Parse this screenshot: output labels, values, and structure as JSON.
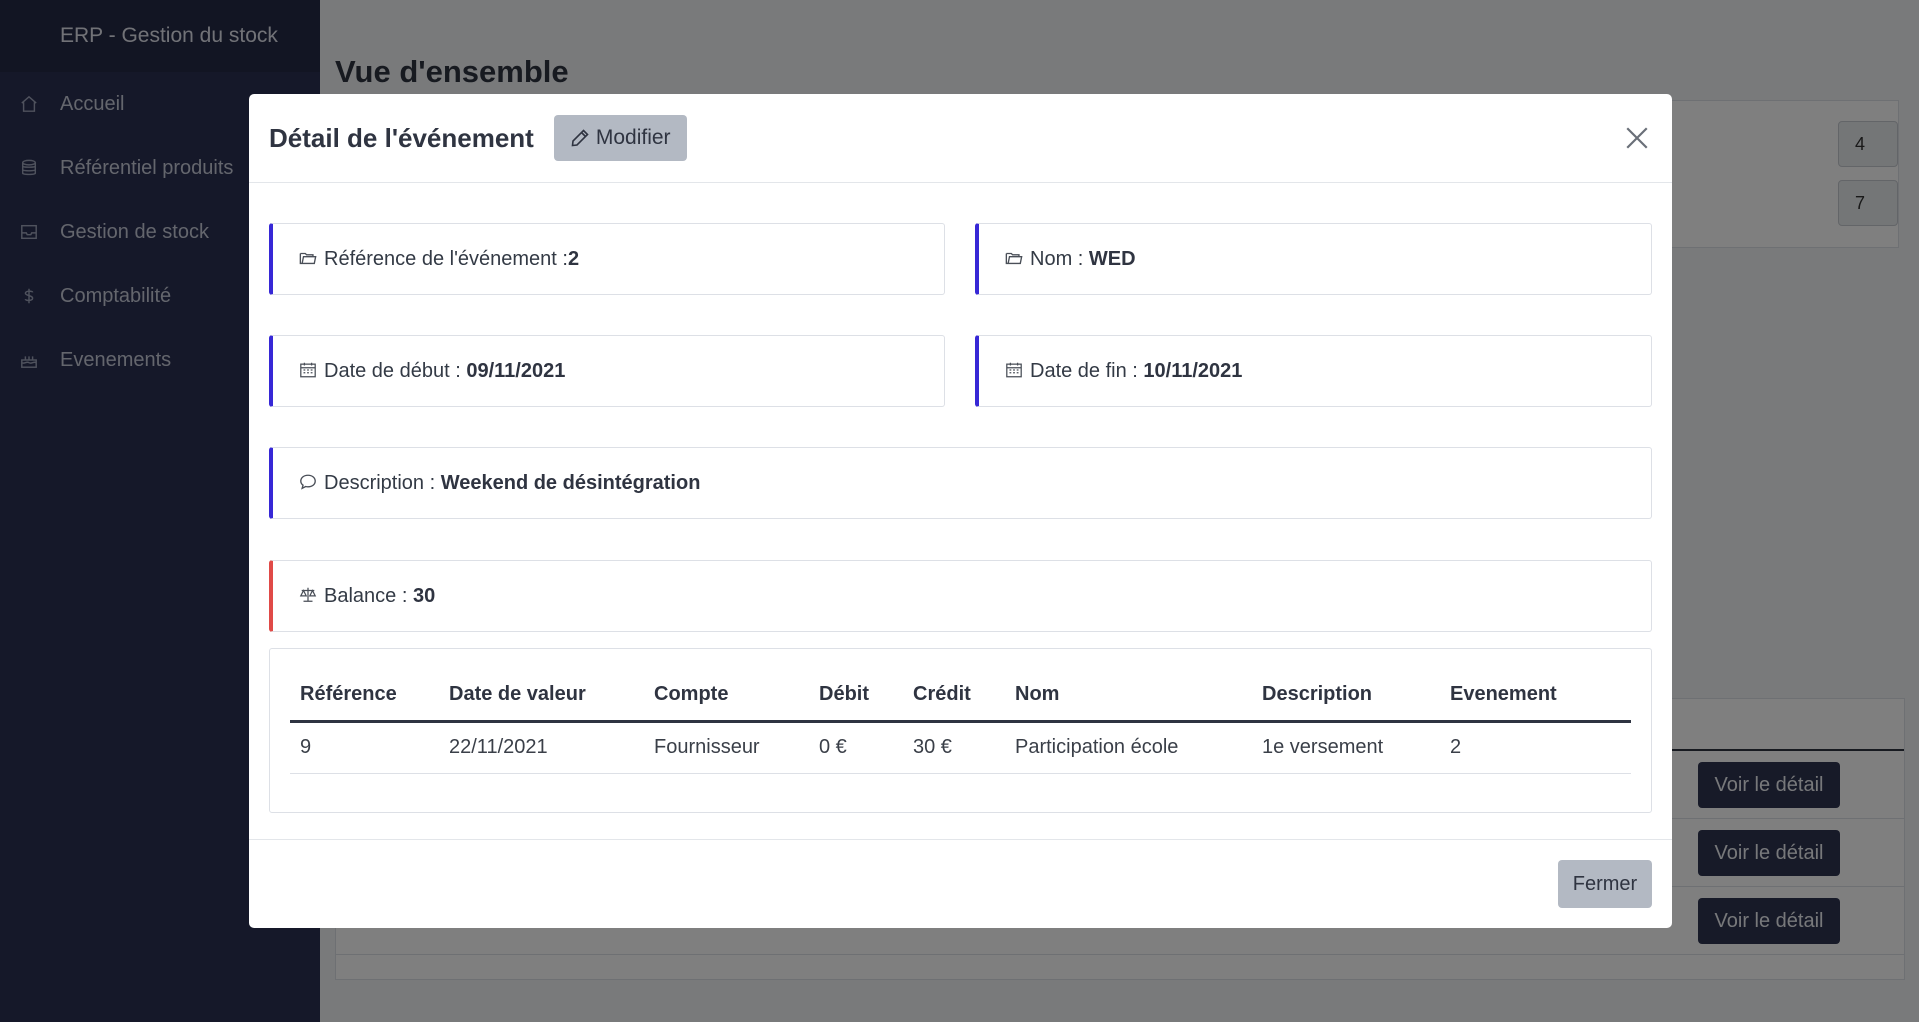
{
  "sidebar": {
    "brand": "ERP - Gestion du stock",
    "items": [
      {
        "label": "Accueil",
        "icon": "home-icon"
      },
      {
        "label": "Référentiel produits",
        "icon": "database-icon"
      },
      {
        "label": "Gestion de stock",
        "icon": "inbox-icon"
      },
      {
        "label": "Comptabilité",
        "icon": "dollar-icon"
      },
      {
        "label": "Evenements",
        "icon": "cake-icon"
      }
    ]
  },
  "main": {
    "title": "Vue d'ensemble",
    "counts": [
      "4",
      "7"
    ],
    "detail_button": "Voir le détail"
  },
  "modal": {
    "title": "Détail de l'événement",
    "modify_label": "Modifier",
    "fields": {
      "reference": {
        "label": "Référence de l'événement :",
        "value": "2"
      },
      "nom": {
        "label": "Nom : ",
        "value": "WED"
      },
      "date_debut": {
        "label": "Date de début : ",
        "value": "09/11/2021"
      },
      "date_fin": {
        "label": "Date de fin : ",
        "value": "10/11/2021"
      },
      "description": {
        "label": "Description : ",
        "value": "Weekend de désintégration"
      },
      "balance": {
        "label": "Balance : ",
        "value": "30"
      }
    },
    "table": {
      "headers": [
        "Référence",
        "Date de valeur",
        "Compte",
        "Débit",
        "Crédit",
        "Nom",
        "Description",
        "Evenement"
      ],
      "rows": [
        {
          "reference": "9",
          "date_valeur": "22/11/2021",
          "compte": "Fournisseur",
          "debit": "0 €",
          "credit": "30 €",
          "nom": "Participation école",
          "description": "1e versement",
          "evenement": "2"
        }
      ]
    },
    "close_label": "Fermer"
  },
  "colors": {
    "sidebar_bg": "#2a3052",
    "card_accent": "#3728d6",
    "balance_accent": "#e04a47",
    "debit": "#e52222",
    "credit": "#3b8a1f"
  }
}
